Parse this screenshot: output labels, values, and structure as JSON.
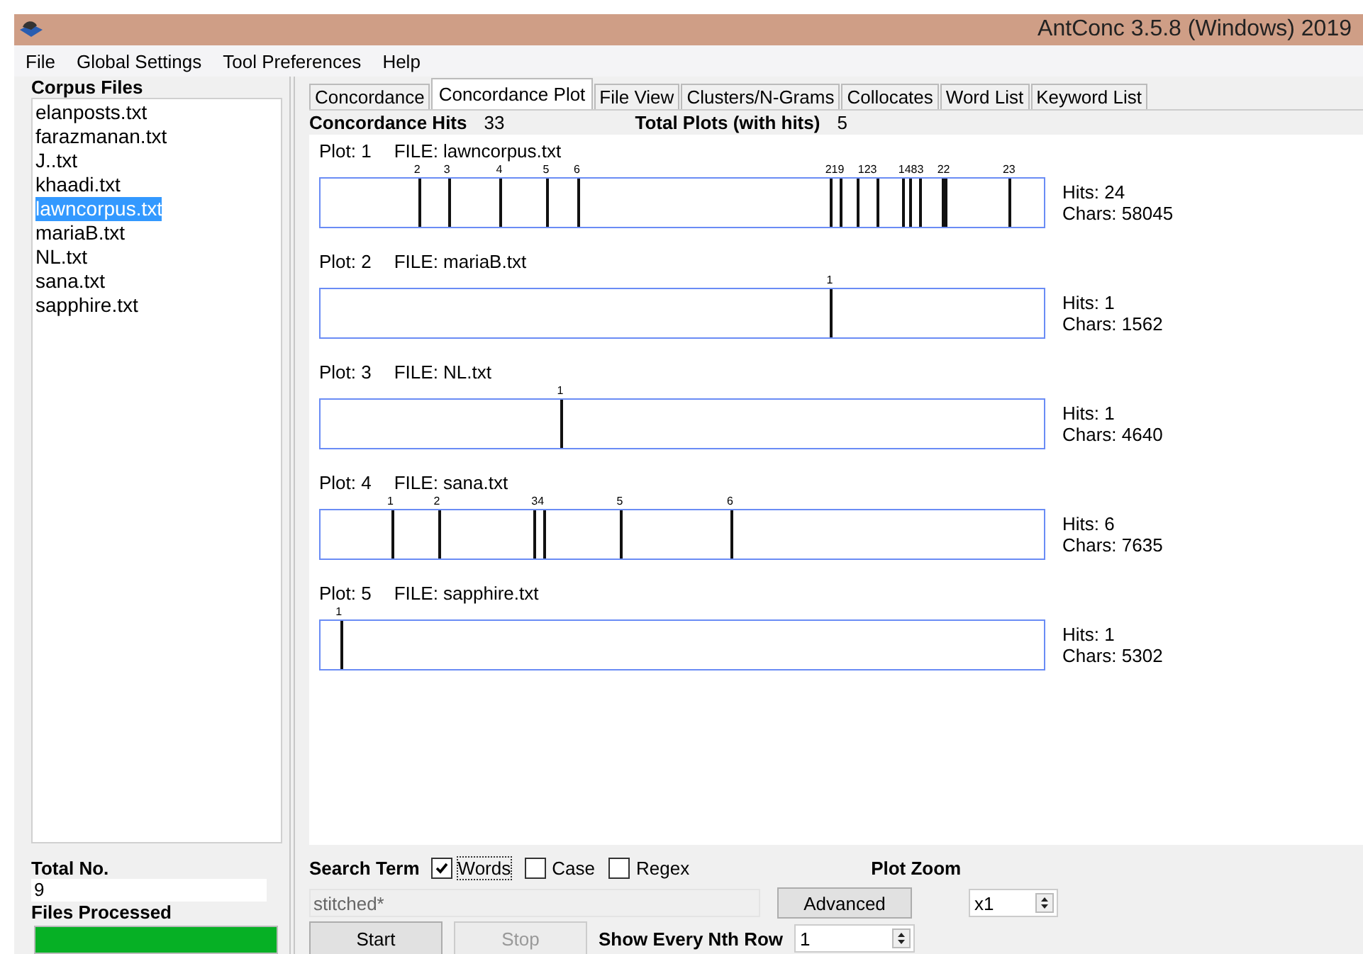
{
  "window": {
    "title": "AntConc 3.5.8 (Windows) 2019"
  },
  "menu": [
    "File",
    "Global Settings",
    "Tool Preferences",
    "Help"
  ],
  "corpus_files": {
    "heading": "Corpus Files",
    "items": [
      {
        "label": "elanposts.txt",
        "selected": false
      },
      {
        "label": "farazmanan.txt",
        "selected": false
      },
      {
        "label": "J..txt",
        "selected": false
      },
      {
        "label": "khaadi.txt",
        "selected": false
      },
      {
        "label": "lawncorpus.txt",
        "selected": true
      },
      {
        "label": "mariaB.txt",
        "selected": false
      },
      {
        "label": "NL.txt",
        "selected": false
      },
      {
        "label": "sana.txt",
        "selected": false
      },
      {
        "label": "sapphire.txt",
        "selected": false
      }
    ]
  },
  "total": {
    "label": "Total No.",
    "value": "9"
  },
  "files_processed": {
    "label": "Files Processed",
    "level": 1
  },
  "tabs": [
    {
      "label": "Concordance",
      "selected": false
    },
    {
      "label": "Concordance Plot",
      "selected": true
    },
    {
      "label": "File View",
      "selected": false
    },
    {
      "label": "Clusters/N-Grams",
      "selected": false
    },
    {
      "label": "Collocates",
      "selected": false
    },
    {
      "label": "Word List",
      "selected": false
    },
    {
      "label": "Keyword List",
      "selected": false
    }
  ],
  "summary": {
    "hits_label": "Concordance Hits",
    "hits": "33",
    "plots_label": "Total Plots (with hits)",
    "plots": "5"
  },
  "plots": [
    {
      "plot": "Plot: 1",
      "file": "FILE: lawncorpus.txt",
      "hits": "Hits: 24",
      "chars": "Chars: 58045",
      "marks": [
        {
          "level": 0.135
        },
        {
          "level": 0.176
        },
        {
          "level": 0.248
        },
        {
          "level": 0.3125
        },
        {
          "level": 0.355
        },
        {
          "level": 0.703
        },
        {
          "level": 0.717
        },
        {
          "level": 0.742
        },
        {
          "level": 0.768
        },
        {
          "level": 0.803
        },
        {
          "level": 0.814
        },
        {
          "level": 0.828
        },
        {
          "level": 0.859
        },
        {
          "level": 0.863
        },
        {
          "level": 0.951
        }
      ],
      "labels": [
        {
          "text": "2",
          "level": 0.135
        },
        {
          "text": "3",
          "level": 0.176
        },
        {
          "text": "4",
          "level": 0.248
        },
        {
          "text": "5",
          "level": 0.3125
        },
        {
          "text": "6",
          "level": 0.355
        },
        {
          "text": "219",
          "level": 0.71
        },
        {
          "text": "123",
          "level": 0.755
        },
        {
          "text": "1483",
          "level": 0.815
        },
        {
          "text": "22",
          "level": 0.86
        },
        {
          "text": "23",
          "level": 0.95
        }
      ]
    },
    {
      "plot": "Plot: 2",
      "file": "FILE: mariaB.txt",
      "hits": "Hits: 1",
      "chars": "Chars: 1562",
      "marks": [
        {
          "level": 0.703
        }
      ],
      "labels": [
        {
          "text": "1",
          "level": 0.703
        }
      ]
    },
    {
      "plot": "Plot: 3",
      "file": "FILE: NL.txt",
      "hits": "Hits: 1",
      "chars": "Chars: 4640",
      "marks": [
        {
          "level": 0.332
        }
      ],
      "labels": [
        {
          "text": "1",
          "level": 0.332
        }
      ]
    },
    {
      "plot": "Plot: 4",
      "file": "FILE: sana.txt",
      "hits": "Hits: 6",
      "chars": "Chars: 7635",
      "marks": [
        {
          "level": 0.098
        },
        {
          "level": 0.162
        },
        {
          "level": 0.295
        },
        {
          "level": 0.307
        },
        {
          "level": 0.414
        },
        {
          "level": 0.566
        }
      ],
      "labels": [
        {
          "text": "1",
          "level": 0.098
        },
        {
          "text": "2",
          "level": 0.162
        },
        {
          "text": "34",
          "level": 0.301
        },
        {
          "text": "5",
          "level": 0.414
        },
        {
          "text": "6",
          "level": 0.566
        }
      ]
    },
    {
      "plot": "Plot: 5",
      "file": "FILE: sapphire.txt",
      "hits": "Hits: 1",
      "chars": "Chars: 5302",
      "marks": [
        {
          "level": 0.027
        }
      ],
      "labels": [
        {
          "text": "1",
          "level": 0.027
        }
      ]
    }
  ],
  "search": {
    "label": "Search Term",
    "options": [
      {
        "label": "Words",
        "checked": true
      },
      {
        "label": "Case",
        "checked": false
      },
      {
        "label": "Regex",
        "checked": false
      }
    ],
    "value": "stitched*",
    "advanced": "Advanced"
  },
  "plot_zoom": {
    "label": "Plot Zoom",
    "value": "x1"
  },
  "buttons": [
    {
      "label": "Start",
      "disabled": false
    },
    {
      "label": "Stop",
      "disabled": true
    }
  ],
  "nth_row": {
    "label": "Show Every Nth Row",
    "value": "1"
  }
}
